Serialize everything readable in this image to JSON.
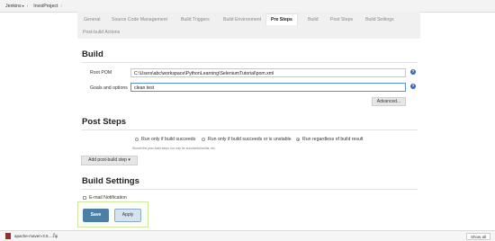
{
  "breadcrumb": {
    "items": [
      "Jenkins",
      "InvoiProject"
    ]
  },
  "tabs": [
    {
      "label": "General"
    },
    {
      "label": "Source Code Management"
    },
    {
      "label": "Build Triggers"
    },
    {
      "label": "Build Environment"
    },
    {
      "label": "Pre Steps",
      "active": true
    },
    {
      "label": "Build"
    },
    {
      "label": "Post Steps"
    },
    {
      "label": "Build Settings"
    },
    {
      "label": "Post-build Actions"
    }
  ],
  "build": {
    "title": "Build",
    "root_pom_label": "Root POM",
    "root_pom_value": "C:\\Users\\abc\\workspace\\PythonLearning\\SeleniumTutorial\\pom.xml",
    "goals_label": "Goals and options",
    "goals_value": "clean test",
    "advanced_label": "Advanced..."
  },
  "post_steps": {
    "title": "Post Steps",
    "options": [
      {
        "label": "Run only if build succeeds",
        "selected": false
      },
      {
        "label": "Run only if build succeeds or is unstable",
        "selected": false
      },
      {
        "label": "Run regardless of build result",
        "selected": true
      }
    ],
    "hint": "Should the post-build steps run only for successful builds, etc.",
    "add_step_label": "Add post-build step"
  },
  "build_settings": {
    "title": "Build Settings",
    "email_label": "E-mail Notification",
    "email_checked": false
  },
  "actions": {
    "save_label": "Save",
    "apply_label": "Apply"
  },
  "downloads": {
    "file_label": "apache-maven-3.5....zip",
    "show_all_label": "Show all"
  }
}
